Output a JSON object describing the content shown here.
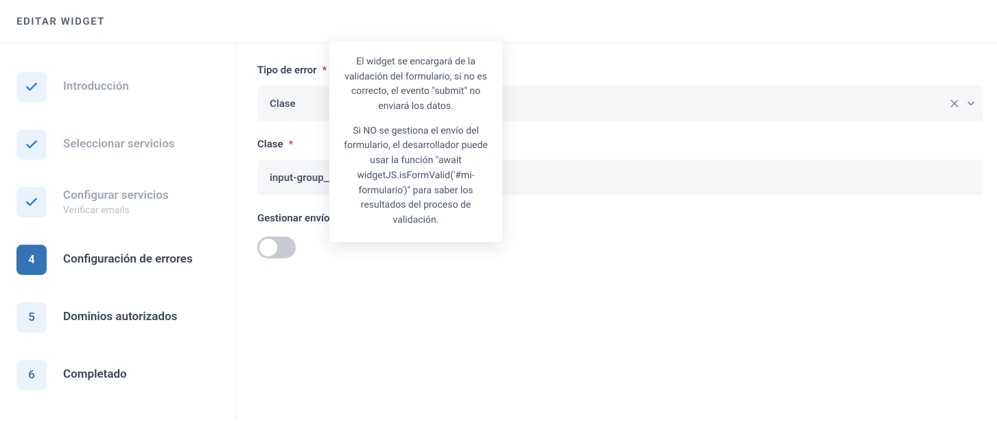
{
  "header": {
    "title": "EDITAR WIDGET"
  },
  "sidebar": {
    "steps": [
      {
        "kind": "check",
        "label": "Introducción",
        "state": "done"
      },
      {
        "kind": "check",
        "label": "Seleccionar servicios",
        "state": "done"
      },
      {
        "kind": "check",
        "label": "Configurar servicios",
        "sub": "Verificar emails",
        "state": "done"
      },
      {
        "kind": "num",
        "num": "4",
        "label": "Configuración de errores",
        "state": "active"
      },
      {
        "kind": "num",
        "num": "5",
        "label": "Dominios autorizados",
        "state": "future"
      },
      {
        "kind": "num",
        "num": "6",
        "label": "Completado",
        "state": "future"
      }
    ]
  },
  "form": {
    "error_type": {
      "label": "Tipo de error",
      "value": "Clase"
    },
    "class": {
      "label": "Clase",
      "value": "input-group__error"
    },
    "manage": {
      "label": "Gestionar envío del formulario",
      "on": false
    }
  },
  "tooltip": {
    "p1": "El widget se encargará de la validación del formulario, si no es correcto, el evento \"submit\" no enviará los datos.",
    "p2": "Si NO se gestiona el envío del formulario, el desarrollador puede usar la función \"await widgetJS.isFormValid('#mi-formulario')\" para saber los resultados del proceso de validación."
  }
}
